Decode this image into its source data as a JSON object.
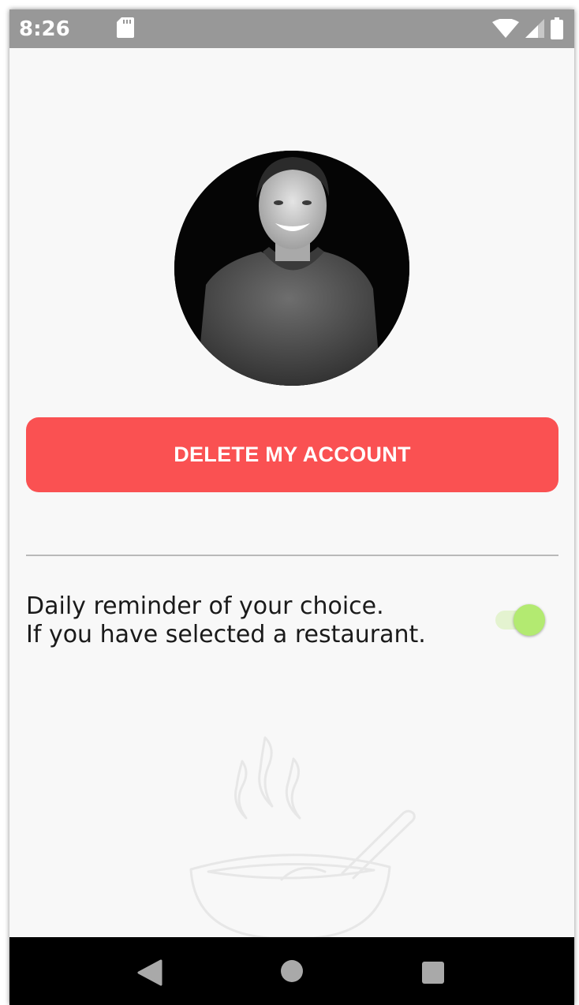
{
  "status_bar": {
    "time": "8:26",
    "icons": [
      "sd-card-icon",
      "wifi-icon",
      "cell-signal-icon",
      "battery-icon"
    ]
  },
  "profile": {
    "avatar_icon": "user-photo"
  },
  "actions": {
    "delete_label": "DELETE MY ACCOUNT",
    "delete_color": "#fa5152"
  },
  "settings": {
    "reminder_line1": "Daily reminder of your choice.",
    "reminder_line2": "If you have selected a restaurant.",
    "reminder_enabled": true,
    "toggle_color": "#b3ea71"
  },
  "decoration": {
    "watermark_icon": "soup-bowl-icon"
  },
  "nav_bar": {
    "buttons": [
      "back-icon",
      "home-icon",
      "recents-icon"
    ]
  }
}
